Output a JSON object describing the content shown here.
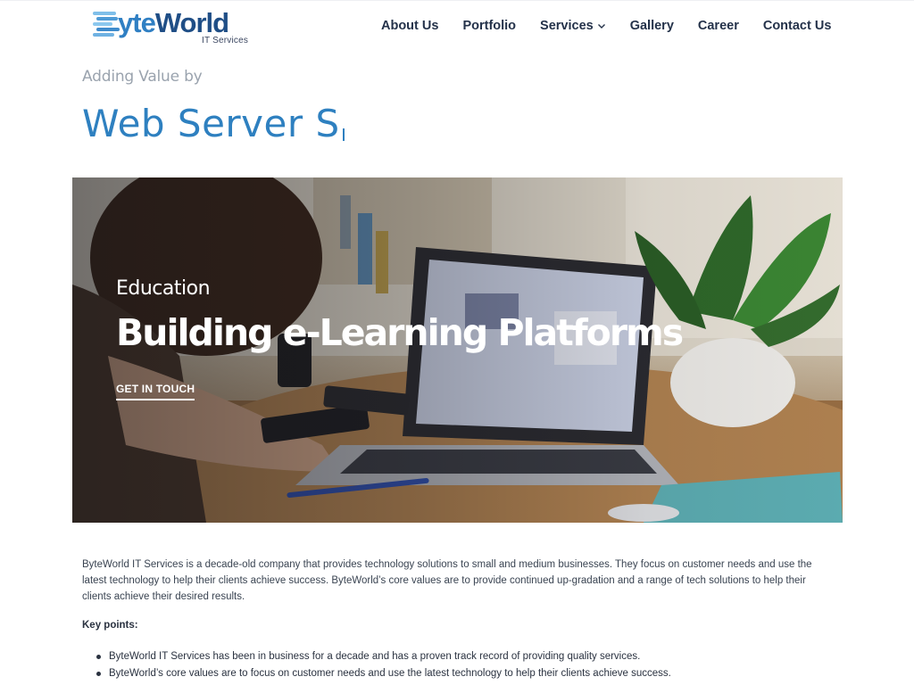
{
  "brand": {
    "name_part1": "yte",
    "name_part2": "World",
    "subtitle": "IT Services",
    "primary_color": "#2f7fc3",
    "dark_color": "#1f4e86"
  },
  "nav": {
    "items": [
      {
        "label": "About Us"
      },
      {
        "label": "Portfolio"
      },
      {
        "label": "Services",
        "has_dropdown": true
      },
      {
        "label": "Gallery"
      },
      {
        "label": "Career"
      },
      {
        "label": "Contact Us"
      }
    ]
  },
  "hero": {
    "eyebrow": "Adding Value by",
    "typed_text": "Web Server S"
  },
  "banner": {
    "eyebrow": "Education",
    "title": "Building e-Learning Platforms",
    "cta": "GET IN TOUCH"
  },
  "content": {
    "intro": "ByteWorld IT Services is a decade-old company that provides technology solutions to small and medium businesses. They focus on customer needs and use the latest technology to help their clients achieve success. ByteWorld’s core values are to provide continued up-gradation and a range of tech solutions to help their clients achieve their desired results.",
    "key_points_label": "Key points:",
    "key_points": [
      "ByteWorld IT Services has been in business for a decade and has a proven track record of providing quality services.",
      "ByteWorld’s core values are to focus on customer needs and use the latest technology to help their clients achieve success."
    ]
  }
}
